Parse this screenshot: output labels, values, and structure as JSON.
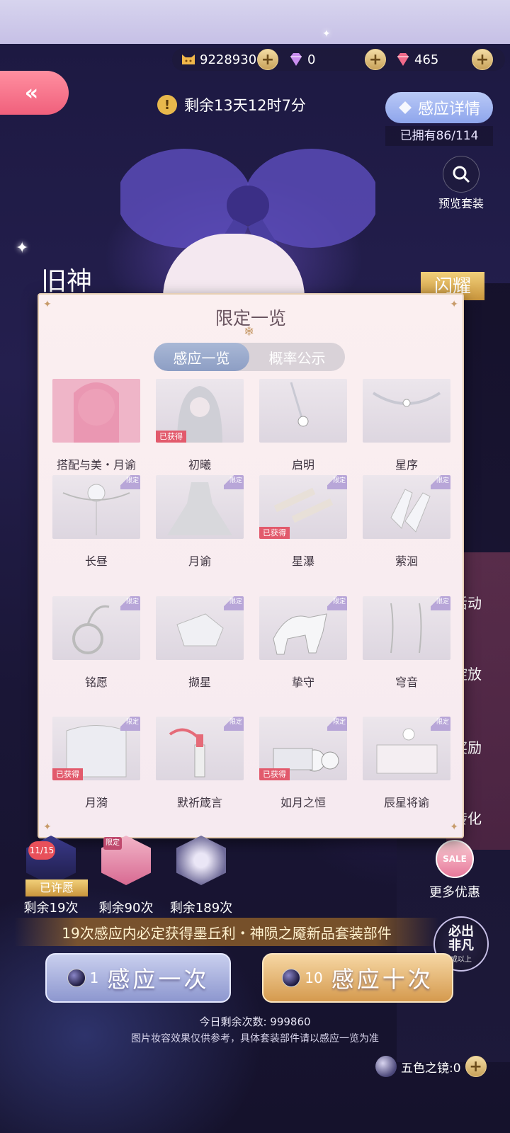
{
  "currency": {
    "coins": "9228930",
    "diamonds": "0",
    "crystals": "465",
    "plus_symbol": "+"
  },
  "back_symbol": "«",
  "countdown": {
    "icon_symbol": "!",
    "text": "剩余13天12时7分"
  },
  "detail_button": "感应详情",
  "owned_text": "已拥有86/114",
  "preview_button": "预览套装",
  "side_fragments": {
    "left": "旧神",
    "right": "闪耀"
  },
  "side_menu": [
    "活动",
    "绽放",
    "奖励",
    "转化"
  ],
  "more_deals": {
    "sale_text": "SALE",
    "label": "更多优惠"
  },
  "modal": {
    "title": "限定一览",
    "tabs": [
      {
        "label": "感应一览",
        "active": true
      },
      {
        "label": "概率公示",
        "active": false
      }
    ],
    "limited_tag": "限定",
    "obtained_badge": "已获得",
    "items": [
      {
        "name": "搭配与美・月谕",
        "obtained": false,
        "limited": false,
        "icon": "portrait-icon"
      },
      {
        "name": "初曦",
        "obtained": true,
        "limited": false,
        "icon": "hair-icon"
      },
      {
        "name": "启明",
        "obtained": false,
        "limited": false,
        "icon": "earring-icon"
      },
      {
        "name": "星序",
        "obtained": false,
        "limited": false,
        "icon": "crown-icon"
      },
      {
        "name": "长昼",
        "obtained": false,
        "limited": true,
        "icon": "headpiece-icon"
      },
      {
        "name": "月谕",
        "obtained": false,
        "limited": true,
        "icon": "dress-icon"
      },
      {
        "name": "星瀑",
        "obtained": true,
        "limited": true,
        "icon": "hairpin-icon"
      },
      {
        "name": "萦洄",
        "obtained": false,
        "limited": true,
        "icon": "shoes-icon"
      },
      {
        "name": "铭愿",
        "obtained": false,
        "limited": true,
        "icon": "ring-icon"
      },
      {
        "name": "撷星",
        "obtained": false,
        "limited": true,
        "icon": "glove-icon"
      },
      {
        "name": "挚守",
        "obtained": false,
        "limited": true,
        "icon": "unicorn-icon"
      },
      {
        "name": "穹音",
        "obtained": false,
        "limited": true,
        "icon": "earrings-icon"
      },
      {
        "name": "月漪",
        "obtained": true,
        "limited": true,
        "icon": "veil-icon"
      },
      {
        "name": "默祈箴言",
        "obtained": false,
        "limited": true,
        "icon": "lipstick-icon"
      },
      {
        "name": "如月之恒",
        "obtained": true,
        "limited": true,
        "icon": "handheld-icon"
      },
      {
        "name": "辰星将谕",
        "obtained": false,
        "limited": true,
        "icon": "scene-icon"
      }
    ]
  },
  "wishes": [
    {
      "badge": "11/15",
      "status": "已许愿",
      "remain": "剩余19次"
    },
    {
      "badge": "限定",
      "status": "",
      "remain": "剩余90次"
    },
    {
      "badge": "",
      "status": "",
      "remain": "剩余189次"
    }
  ],
  "guarantee_text": "19次感应内必定获得墨丘利・神陨之魇新品套装部件",
  "fan_badge": {
    "line1": "必出",
    "line2": "非凡",
    "line3": "或以上"
  },
  "draw_one": {
    "cost": "1",
    "label": "感应一次"
  },
  "draw_ten": {
    "cost": "10",
    "label": "感应十次"
  },
  "today_left": "今日剩余次数: 999860",
  "disclaimer": "图片妆容效果仅供参考，具体套装部件请以感应一览为准",
  "mirror": {
    "text": "五色之镜:0"
  },
  "colors": {
    "accent_gold": "#c9953c",
    "badge_red": "#e25a6c",
    "tab_active": "#8d9ec4",
    "back_pink": "#f0607c"
  }
}
